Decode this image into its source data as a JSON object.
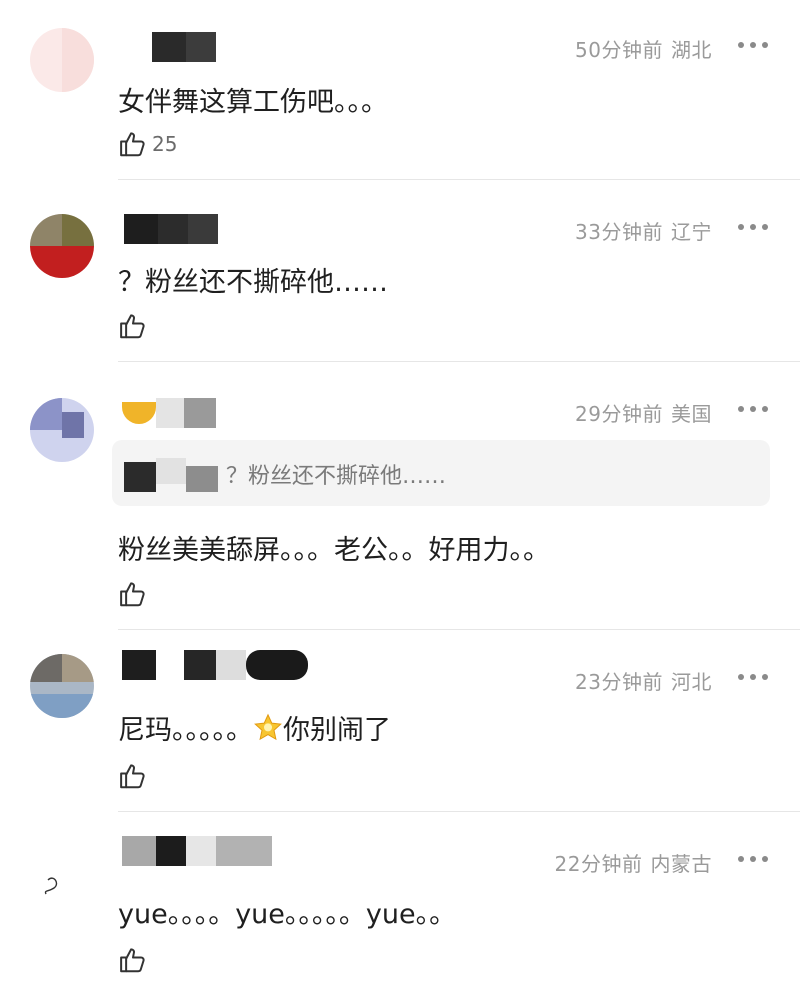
{
  "comments": [
    {
      "time": "50分钟前",
      "location": "湖北",
      "text": "女伴舞这算工伤吧。。。",
      "likes": "25"
    },
    {
      "time": "33分钟前",
      "location": "辽宁",
      "text": "？粉丝还不撕碎他……",
      "likes": ""
    },
    {
      "time": "29分钟前",
      "location": "美国",
      "quote": "？粉丝还不撕碎他……",
      "text": "粉丝美美舔屏。。。老公。。好用力。。",
      "likes": ""
    },
    {
      "time": "23分钟前",
      "location": "河北",
      "text_before": "尼玛。。。。。",
      "emoji": "star-emoji",
      "text_after": "你别闹了",
      "likes": ""
    },
    {
      "time": "22分钟前",
      "location": "内蒙古",
      "text": "yue。。。。yue。。。。。yue。。",
      "likes": ""
    }
  ],
  "icons": {
    "like": "thumbs-up-icon",
    "more": "more-dots-icon"
  },
  "colors": {
    "meta": "#9a9a9a",
    "text": "#1f1f1f",
    "quote_bg": "#f4f4f4",
    "divider": "#e6e6e6"
  }
}
